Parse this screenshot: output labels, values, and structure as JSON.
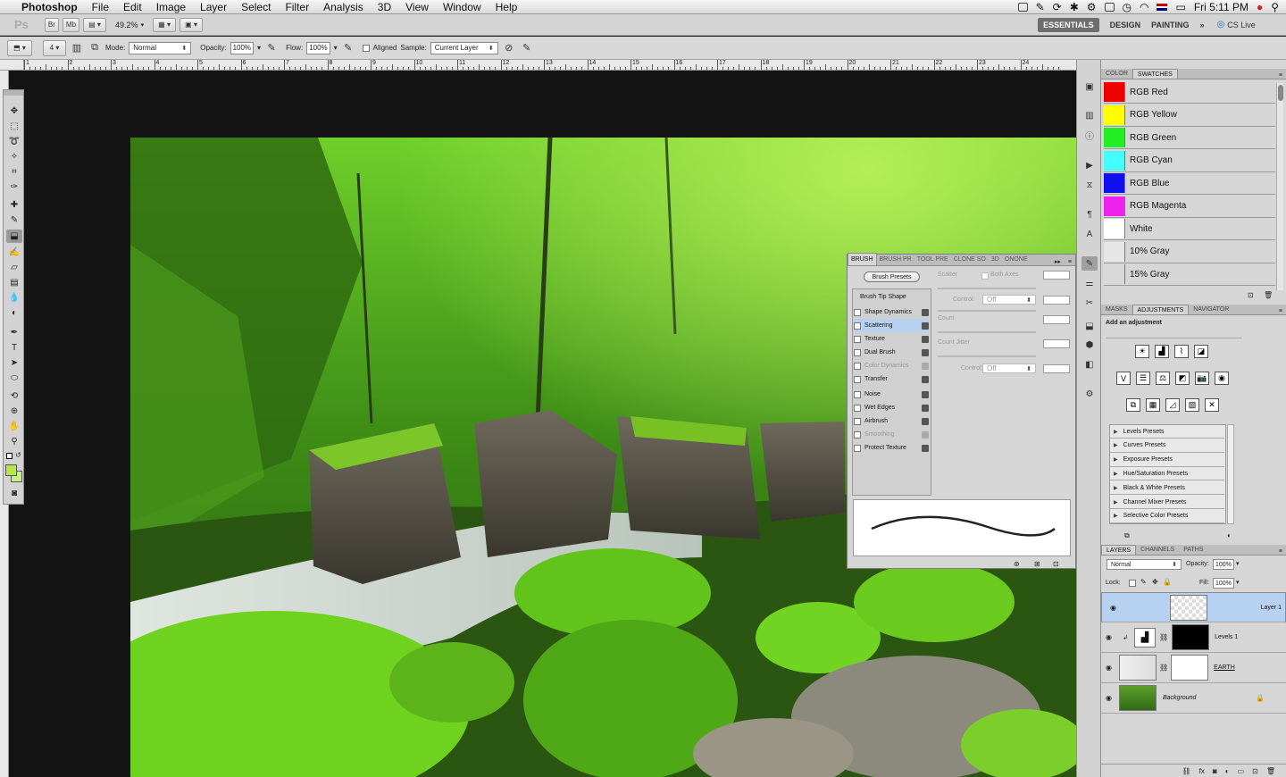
{
  "menubar": {
    "apple": "",
    "app_name": "Photoshop",
    "items": [
      "File",
      "Edit",
      "Image",
      "Layer",
      "Select",
      "Filter",
      "Analysis",
      "3D",
      "View",
      "Window",
      "Help"
    ],
    "clock": "Fri 5:11 PM"
  },
  "appbar": {
    "ps_logo": "Ps",
    "br_label": "Br",
    "mb_label": "Mb",
    "zoom": "49.2%",
    "workspaces": {
      "essentials": "ESSENTIALS",
      "design": "DESIGN",
      "painting": "PAINTING",
      "more": "»"
    },
    "cs_live": "CS Live"
  },
  "options": {
    "brush_size": "4",
    "mode_label": "Mode:",
    "mode_value": "Normal",
    "opacity_label": "Opacity:",
    "opacity_value": "100%",
    "flow_label": "Flow:",
    "flow_value": "100%",
    "aligned_label": "Aligned",
    "sample_label": "Sample:",
    "sample_value": "Current Layer"
  },
  "ruler": {
    "top_numbers": [
      "1",
      "2",
      "3",
      "4",
      "5",
      "6",
      "7",
      "8",
      "9",
      "10",
      "11",
      "12",
      "13",
      "14",
      "15",
      "16",
      "17",
      "18",
      "19",
      "20",
      "21",
      "22",
      "23",
      "24"
    ]
  },
  "swatches_panel": {
    "tabs": [
      "COLOR",
      "SWATCHES"
    ],
    "active_tab": "SWATCHES",
    "swatches": [
      {
        "name": "RGB Red",
        "color": "#ee0000"
      },
      {
        "name": "RGB Yellow",
        "color": "#ffff00"
      },
      {
        "name": "RGB Green",
        "color": "#22ee22"
      },
      {
        "name": "RGB Cyan",
        "color": "#44ffff"
      },
      {
        "name": "RGB Blue",
        "color": "#1010ee"
      },
      {
        "name": "RGB Magenta",
        "color": "#ee22ee"
      },
      {
        "name": "White",
        "color": "#ffffff"
      },
      {
        "name": "10% Gray",
        "color": "#e6e6e6"
      },
      {
        "name": "15% Gray",
        "color": "#d9d9d9"
      }
    ]
  },
  "adjustments_panel": {
    "tabs": [
      "MASKS",
      "ADJUSTMENTS",
      "NAVIGATOR"
    ],
    "active_tab": "ADJUSTMENTS",
    "heading": "Add an adjustment",
    "presets": [
      "Levels Presets",
      "Curves Presets",
      "Exposure Presets",
      "Hue/Saturation Presets",
      "Black & White Presets",
      "Channel Mixer Presets",
      "Selective Color Presets"
    ]
  },
  "layers_panel": {
    "tabs": [
      "LAYERS",
      "CHANNELS",
      "PATHS"
    ],
    "active_tab": "LAYERS",
    "blend_mode": "Normal",
    "opacity_label": "Opacity:",
    "opacity_value": "100%",
    "lock_label": "Lock:",
    "fill_label": "Fill:",
    "fill_value": "100%",
    "layers": [
      {
        "name": "Layer 1",
        "selected": true
      },
      {
        "name": "Levels 1",
        "selected": false
      },
      {
        "name": "EARTH",
        "selected": false
      },
      {
        "name": "Background",
        "selected": false
      }
    ]
  },
  "brush_panel": {
    "tabs": [
      "BRUSH",
      "BRUSH PR",
      "TOOL PRE",
      "CLONE SO",
      "3D",
      "ONONE"
    ],
    "active_tab": "BRUSH",
    "presets_button": "Brush Presets",
    "tip_shape": "Brush Tip Shape",
    "options": [
      {
        "label": "Shape Dynamics",
        "state": "normal"
      },
      {
        "label": "Scattering",
        "state": "highlight"
      },
      {
        "label": "Texture",
        "state": "normal"
      },
      {
        "label": "Dual Brush",
        "state": "normal"
      },
      {
        "label": "Color Dynamics",
        "state": "disabled"
      },
      {
        "label": "Transfer",
        "state": "normal"
      },
      {
        "label": "Noise",
        "state": "normal"
      },
      {
        "label": "Wet Edges",
        "state": "normal"
      },
      {
        "label": "Airbrush",
        "state": "normal"
      },
      {
        "label": "Smoothing",
        "state": "disabled"
      },
      {
        "label": "Protect Texture",
        "state": "normal"
      }
    ],
    "scatter_label": "Scatter",
    "both_axes_label": "Both Axes",
    "control_label": "Control:",
    "control_value": "Off",
    "count_label": "Count",
    "count_jitter_label": "Count Jitter",
    "control2_label": "Control:",
    "control2_value": "Off"
  }
}
